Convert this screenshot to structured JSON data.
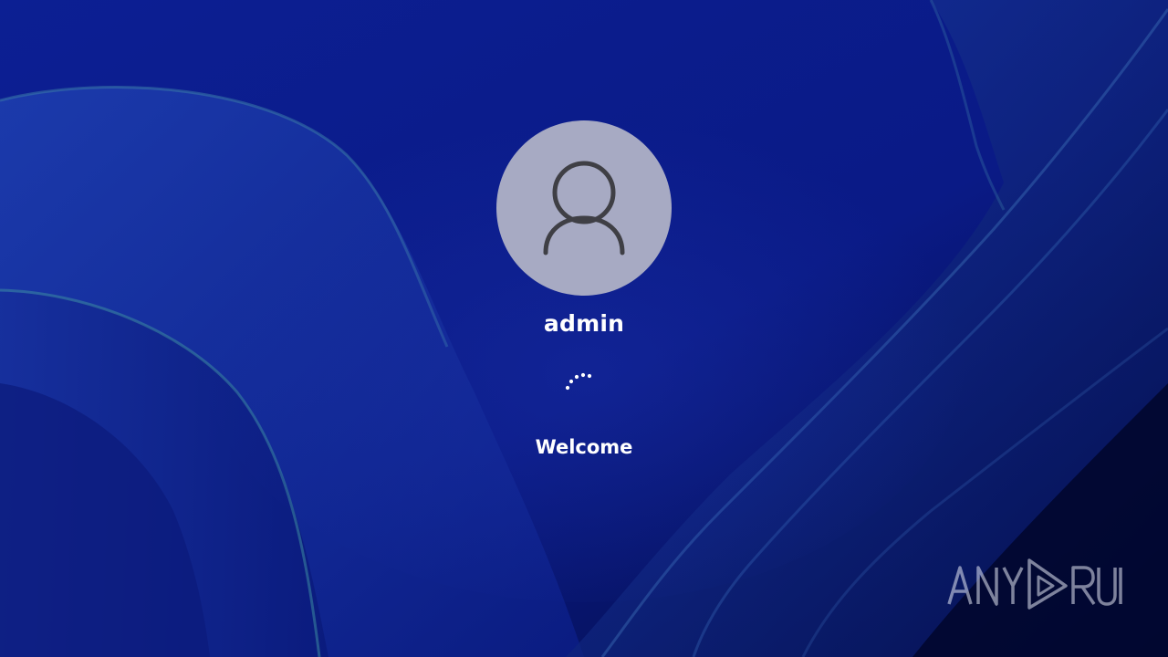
{
  "user": {
    "name": "admin"
  },
  "status": {
    "text": "Welcome"
  },
  "icons": {
    "avatar": "user-icon",
    "spinner": "loading-spinner-icon"
  },
  "watermark": {
    "text": "ANY RUN"
  },
  "colors": {
    "background": "#0a1a8a",
    "avatar_circle": "#a7aac3",
    "avatar_glyph": "#3f3f45",
    "text": "#ffffff"
  }
}
